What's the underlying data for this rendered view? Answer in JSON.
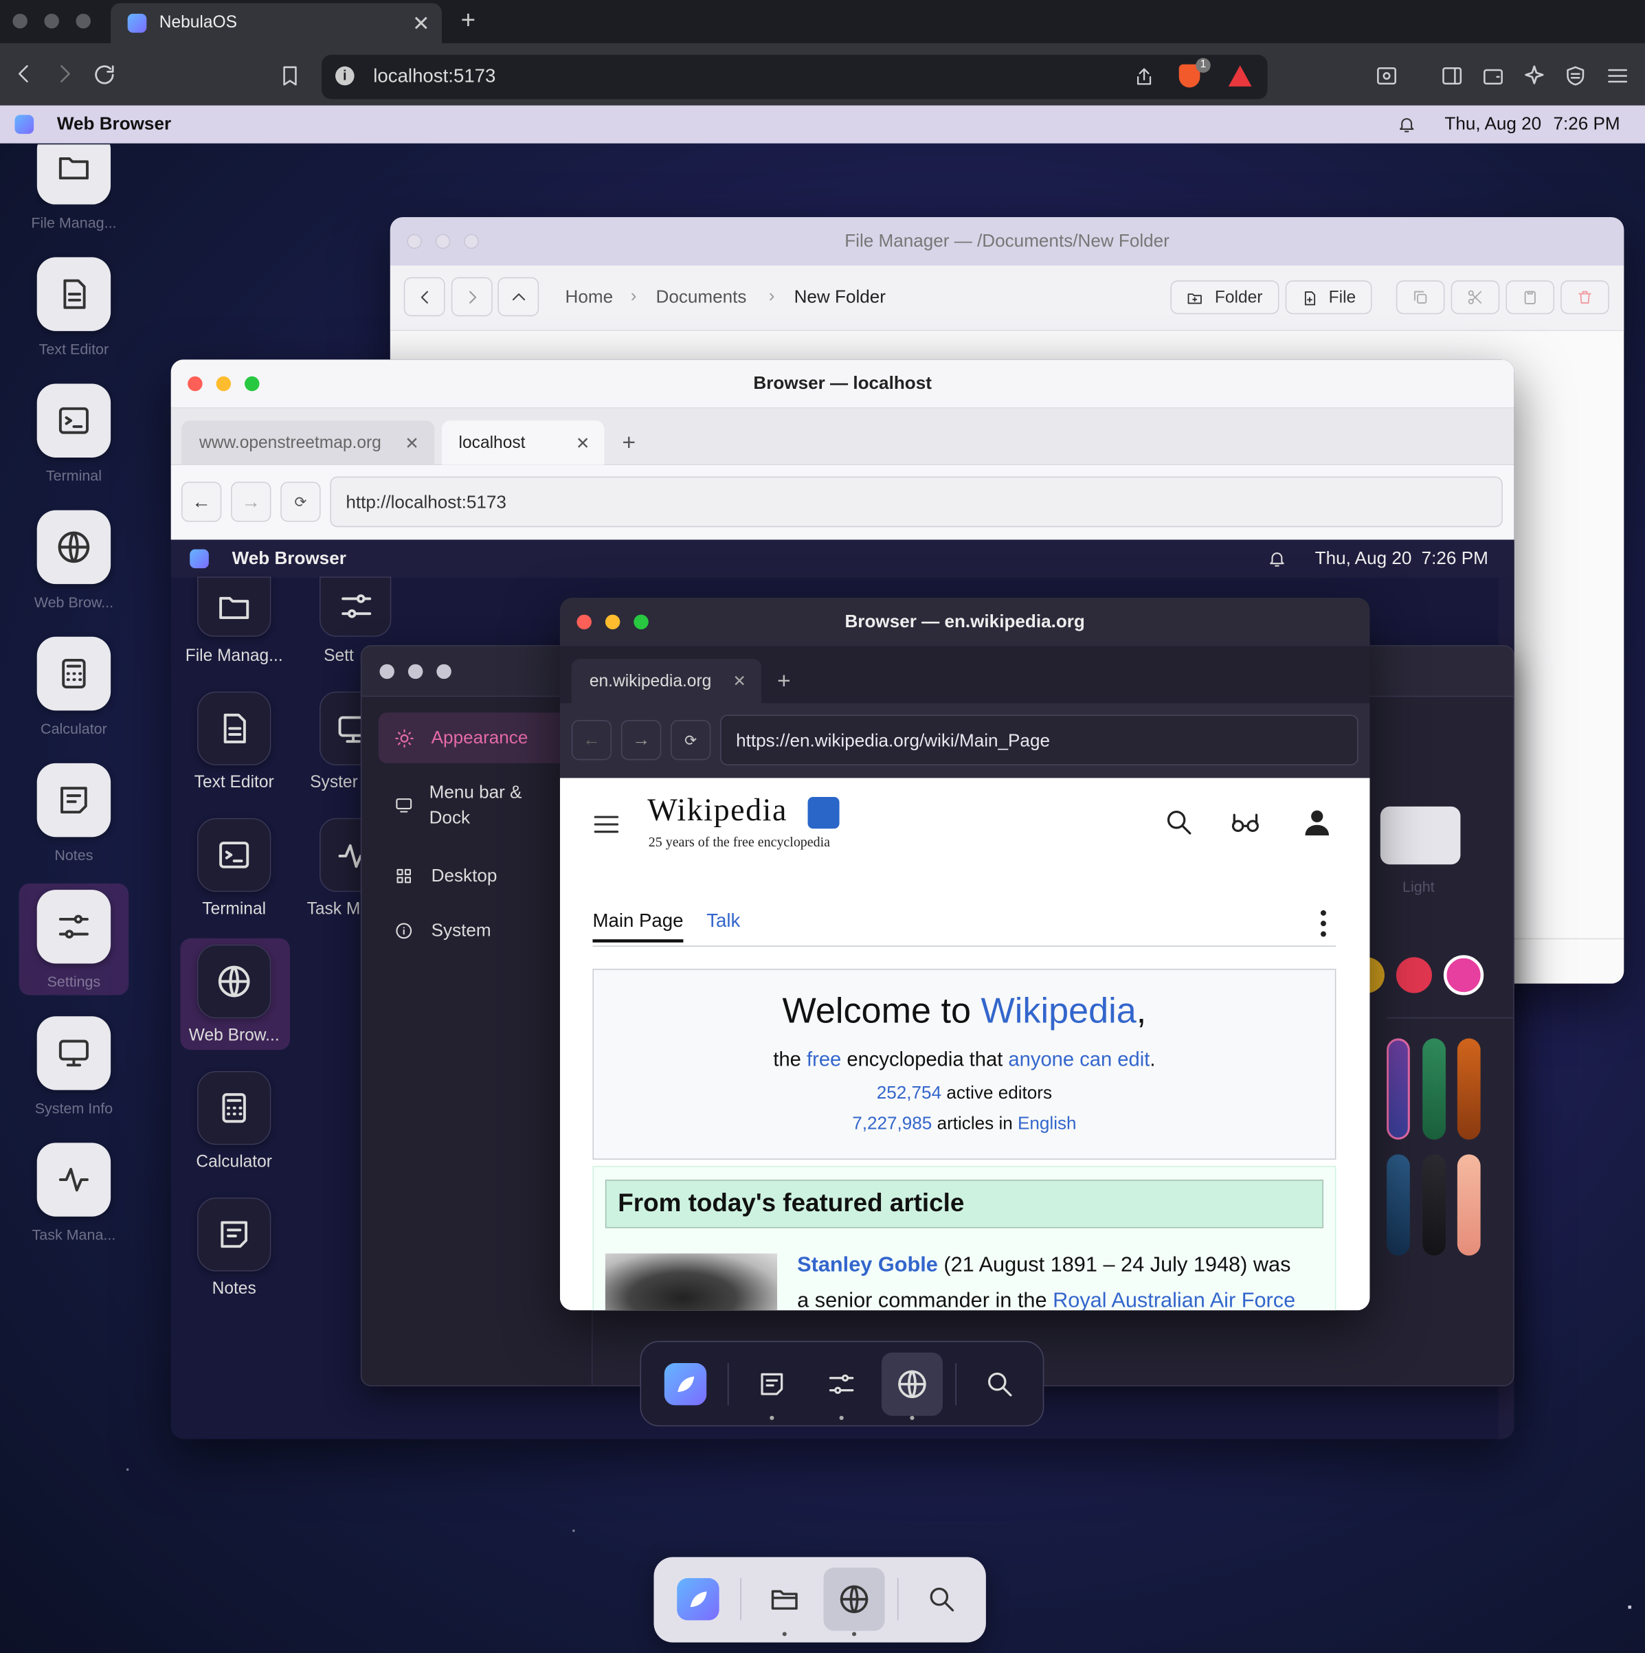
{
  "outer_browser": {
    "tab_title": "NebulaOS",
    "url": "localhost:5173",
    "shield_badge": "1"
  },
  "menubar": {
    "app_name": "Web Browser",
    "date": "Thu, Aug 20",
    "time": "7:26 PM"
  },
  "desktop_icons": [
    {
      "label": "File Manag...",
      "icon": "folder-icon"
    },
    {
      "label": "Text Editor",
      "icon": "document-icon"
    },
    {
      "label": "Terminal",
      "icon": "terminal-icon"
    },
    {
      "label": "Web Brow...",
      "icon": "globe-icon"
    },
    {
      "label": "Calculator",
      "icon": "calculator-icon"
    },
    {
      "label": "Notes",
      "icon": "notes-icon"
    },
    {
      "label": "Settings",
      "icon": "sliders-icon"
    },
    {
      "label": "System Info",
      "icon": "monitor-icon"
    },
    {
      "label": "Task Mana...",
      "icon": "activity-icon"
    }
  ],
  "file_manager": {
    "title": "File Manager — /Documents/New Folder",
    "breadcrumb": [
      "Home",
      "Documents",
      "New Folder"
    ],
    "folder_label": "Folder",
    "file_label": "File"
  },
  "browser_localhost": {
    "title": "Browser — localhost",
    "tabs": [
      {
        "label": "www.openstreetmap.org"
      },
      {
        "label": "localhost"
      }
    ],
    "url": "http://localhost:5173"
  },
  "inner_menubar": {
    "app_name": "Web Browser",
    "date": "Thu, Aug 20",
    "time": "7:26 PM"
  },
  "inner_desktop_icons": [
    {
      "label": "File Manag..."
    },
    {
      "label": "Text Editor"
    },
    {
      "label": "Terminal"
    },
    {
      "label": "Web Brow..."
    },
    {
      "label": "Calculator"
    },
    {
      "label": "Notes"
    },
    {
      "label": "Sett"
    },
    {
      "label": "Syster"
    },
    {
      "label": "Task M"
    }
  ],
  "settings": {
    "nav": [
      {
        "label": "Appearance"
      },
      {
        "label": "Menu bar &",
        "label2": "Dock"
      },
      {
        "label": "Desktop"
      },
      {
        "label": "System"
      }
    ],
    "accent_colors": [
      "#d4a11e",
      "#e0364f",
      "#e63fa0"
    ],
    "light_label": "Light"
  },
  "wiki_browser": {
    "title": "Browser — en.wikipedia.org",
    "tab": "en.wikipedia.org",
    "url": "https://en.wikipedia.org/wiki/Main_Page"
  },
  "wikipedia": {
    "logo": "Wikipedia",
    "tagline": "25 years of the free encyclopedia",
    "tabs": [
      "Main Page",
      "Talk"
    ],
    "welcome_pre": "Welcome to ",
    "welcome_link": "Wikipedia",
    "welcome_post": ",",
    "sub_pre": "the ",
    "sub_free": "free",
    "sub_mid": " encyclopedia that ",
    "sub_edit": "anyone can edit",
    "sub_end": ".",
    "editors_count": "252,754",
    "editors_text": " active editors",
    "articles_count": "7,227,985",
    "articles_text": " articles in ",
    "articles_lang": "English",
    "featured_heading": "From today's featured article",
    "featured_name": "Stanley Goble",
    "featured_text1": " (21 August 1891 – 24 July 1948) was",
    "featured_text2": "a senior commander in the ",
    "featured_link2": "Royal Australian Air Force"
  }
}
